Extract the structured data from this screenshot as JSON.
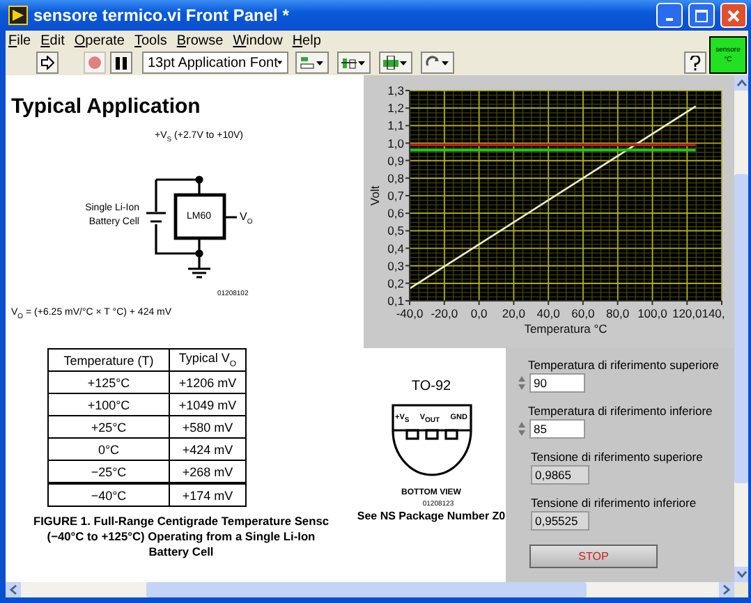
{
  "window": {
    "title": "sensore termico.vi Front Panel *"
  },
  "menu": [
    "File",
    "Edit",
    "Operate",
    "Tools",
    "Browse",
    "Window",
    "Help"
  ],
  "toolbar": {
    "font": "13pt Application Font"
  },
  "vi_icon": {
    "lines": [
      "sensore",
      "°C"
    ]
  },
  "document": {
    "heading": "Typical Application",
    "circuit": {
      "supply": "+V$_{S}$ (+2.7V to +10V)",
      "battery": [
        "Single Li-Ion",
        "Battery Cell"
      ],
      "chip": "LM60",
      "output": "V$_{O}$",
      "code": "01208102"
    },
    "formula": "V$_{O}$ = (+6.25 mV/°C × T °C) + 424 mV",
    "table": {
      "columns": [
        "Temperature (T)",
        "Typical V$_{O}$"
      ],
      "rows": [
        [
          "+125°C",
          "+1206 mV"
        ],
        [
          "+100°C",
          "+1049 mV"
        ],
        [
          "+25°C",
          "+580 mV"
        ],
        [
          "0°C",
          "+424 mV"
        ],
        [
          "−25°C",
          "+268 mV"
        ],
        [
          "−40°C",
          "+174 mV"
        ]
      ]
    },
    "caption_lines": [
      "FIGURE 1. Full-Range Centigrade Temperature Sensc",
      "(−40°C to +125°C) Operating from a Single Li-Ion",
      "Battery Cell"
    ],
    "package": {
      "title": "TO-92",
      "pins": [
        "+V$_{S}$",
        "V$_{OUT}$",
        "GND"
      ],
      "view": "BOTTOM VIEW",
      "code": "01208123",
      "note": "See NS Package Number Z0"
    }
  },
  "graph": {
    "chart_data": {
      "type": "line",
      "xlabel": "Temperatura °C",
      "ylabel": "Volt",
      "x": [
        -40,
        125
      ],
      "series": [
        {
          "color": "#f0f0c8",
          "values": [
            0.17,
            1.21
          ]
        },
        {
          "color": "#b02020",
          "values": [
            0.99,
            0.99
          ]
        },
        {
          "color": "#20c820",
          "values": [
            0.96,
            0.96
          ]
        }
      ],
      "grid": true,
      "xlim": [
        -40,
        140
      ],
      "ylim": [
        0.1,
        1.3
      ],
      "xticks": [
        {
          "value": -40,
          "label": "-40,0"
        },
        {
          "value": -20,
          "label": "-20,0"
        },
        {
          "value": 0,
          "label": "0,0"
        },
        {
          "value": 20,
          "label": "20,0"
        },
        {
          "value": 40,
          "label": "40,0"
        },
        {
          "value": 60,
          "label": "60,0"
        },
        {
          "value": 80,
          "label": "80,0"
        },
        {
          "value": 100,
          "label": "100,0"
        },
        {
          "value": 120,
          "label": "120,0"
        },
        {
          "value": 140,
          "label": "140,"
        }
      ],
      "yticks": [
        {
          "value": 0.1,
          "label": "0,1"
        },
        {
          "value": 0.2,
          "label": "0,2"
        },
        {
          "value": 0.3,
          "label": "0,3"
        },
        {
          "value": 0.4,
          "label": "0,4"
        },
        {
          "value": 0.5,
          "label": "0,5"
        },
        {
          "value": 0.6,
          "label": "0,6"
        },
        {
          "value": 0.7,
          "label": "0,7"
        },
        {
          "value": 0.8,
          "label": "0,8"
        },
        {
          "value": 0.9,
          "label": "0,9"
        },
        {
          "value": 1.0,
          "label": "1,0"
        },
        {
          "value": 1.1,
          "label": "1,1"
        },
        {
          "value": 1.2,
          "label": "1,2"
        },
        {
          "value": 1.3,
          "label": "1,3"
        }
      ]
    }
  },
  "controls": [
    {
      "kind": "control",
      "label": "Temperatura di riferimento superiore",
      "value": "90"
    },
    {
      "kind": "control",
      "label": "Temperatura di riferimento inferiore",
      "value": "85"
    },
    {
      "kind": "indicator",
      "label": "Tensione di riferimento superiore",
      "value": "0,9865"
    },
    {
      "kind": "indicator",
      "label": "Tensione di riferimento inferiore",
      "value": "0,95525"
    }
  ],
  "stop_button": {
    "label": "STOP"
  }
}
